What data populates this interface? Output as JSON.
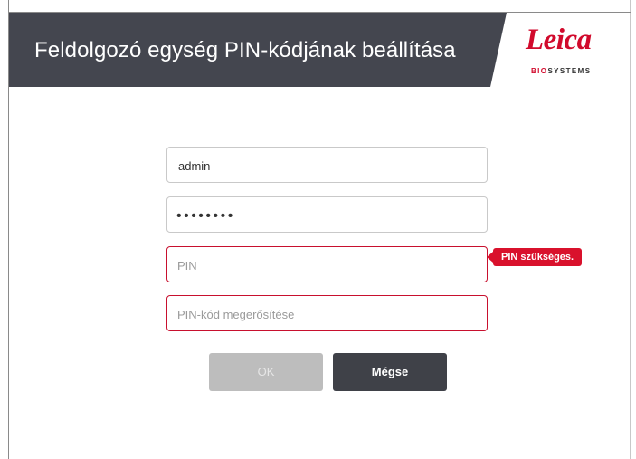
{
  "dialog": {
    "title": "Feldolgozó egység PIN-kódjának beállítása"
  },
  "brand": {
    "name": "Leica",
    "subtitle_red": "BIO",
    "subtitle_rest": "SYSTEMS",
    "color": "#d10a2c"
  },
  "form": {
    "username_value": "admin",
    "password_mask": "••••••••",
    "pin_placeholder": "PIN",
    "pin_confirm_placeholder": "PIN-kód megerősítése",
    "pin_error": "PIN szükséges."
  },
  "buttons": {
    "ok_label": "OK",
    "cancel_label": "Mégse"
  },
  "colors": {
    "header_bg": "#44464f",
    "error": "#d9112c",
    "ok_disabled": "#bdbdbd",
    "cancel_bg": "#3f4148"
  }
}
